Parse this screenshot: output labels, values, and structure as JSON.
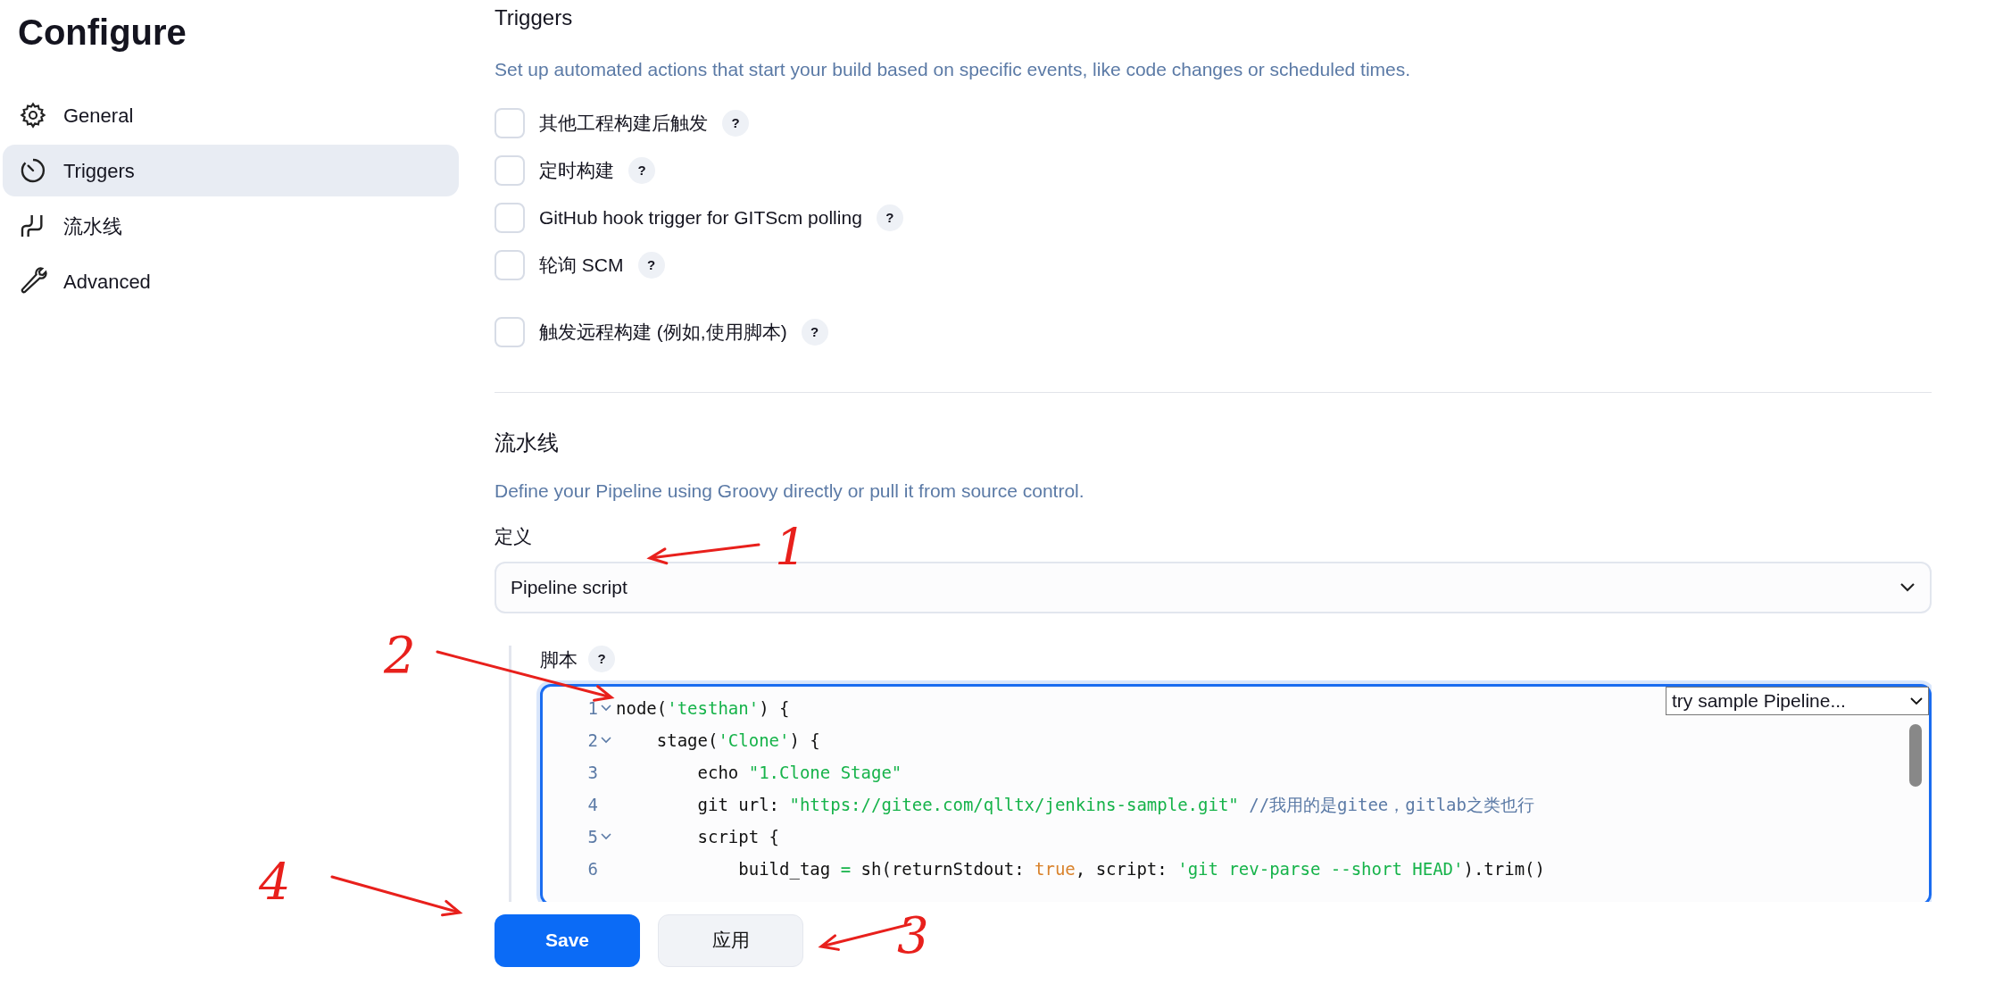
{
  "page_title": "Configure",
  "sidebar": {
    "items": [
      {
        "label": "General",
        "selected": false
      },
      {
        "label": "Triggers",
        "selected": true
      },
      {
        "label": "流水线",
        "selected": false
      },
      {
        "label": "Advanced",
        "selected": false
      }
    ]
  },
  "triggers": {
    "title": "Triggers",
    "description": "Set up automated actions that start your build based on specific events, like code changes or scheduled times.",
    "items": [
      {
        "label": "其他工程构建后触发",
        "checked": false,
        "help": "?"
      },
      {
        "label": "定时构建",
        "checked": false,
        "help": "?"
      },
      {
        "label": "GitHub hook trigger for GITScm polling",
        "checked": false,
        "help": "?"
      },
      {
        "label": "轮询 SCM",
        "checked": false,
        "help": "?"
      },
      {
        "label": "触发远程构建 (例如,使用脚本)",
        "checked": false,
        "help": "?"
      }
    ]
  },
  "pipeline": {
    "title": "流水线",
    "description": "Define your Pipeline using Groovy directly or pull it from source control.",
    "definition_label": "定义",
    "definition_value": "Pipeline script",
    "script_label": "脚本",
    "script_help": "?",
    "sample_select": "try sample Pipeline...",
    "code_lines": [
      {
        "number": "1",
        "foldable": true,
        "tokens": [
          {
            "kind": "plain",
            "text": "node("
          },
          {
            "kind": "string",
            "text": "'testhan'"
          },
          {
            "kind": "plain",
            "text": ") {"
          }
        ]
      },
      {
        "number": "2",
        "foldable": true,
        "tokens": [
          {
            "kind": "plain",
            "text": "    stage("
          },
          {
            "kind": "string",
            "text": "'Clone'"
          },
          {
            "kind": "plain",
            "text": ") {"
          }
        ]
      },
      {
        "number": "3",
        "foldable": false,
        "tokens": [
          {
            "kind": "plain",
            "text": "        echo "
          },
          {
            "kind": "string",
            "text": "\"1.Clone Stage\""
          }
        ]
      },
      {
        "number": "4",
        "foldable": false,
        "tokens": [
          {
            "kind": "plain",
            "text": "        git url: "
          },
          {
            "kind": "string",
            "text": "\"https://gitee.com/qlltx/jenkins-sample.git\""
          },
          {
            "kind": "comment",
            "text": " //我用的是gitee，gitlab之类也行"
          }
        ]
      },
      {
        "number": "5",
        "foldable": true,
        "tokens": [
          {
            "kind": "plain",
            "text": "        script {"
          }
        ]
      },
      {
        "number": "6",
        "foldable": false,
        "tokens": [
          {
            "kind": "plain",
            "text": "            build_tag "
          },
          {
            "kind": "operator",
            "text": "="
          },
          {
            "kind": "plain",
            "text": " sh(returnStdout: "
          },
          {
            "kind": "keyword",
            "text": "true"
          },
          {
            "kind": "plain",
            "text": ", script: "
          },
          {
            "kind": "string",
            "text": "'git rev-parse --short HEAD'"
          },
          {
            "kind": "plain",
            "text": ").trim()"
          }
        ]
      }
    ]
  },
  "buttons": [
    {
      "label": "Save",
      "kind": "primary"
    },
    {
      "label": "应用",
      "kind": "secondary"
    }
  ],
  "annotations": [
    {
      "label": "1"
    },
    {
      "label": "2"
    },
    {
      "label": "3"
    },
    {
      "label": "4"
    }
  ]
}
